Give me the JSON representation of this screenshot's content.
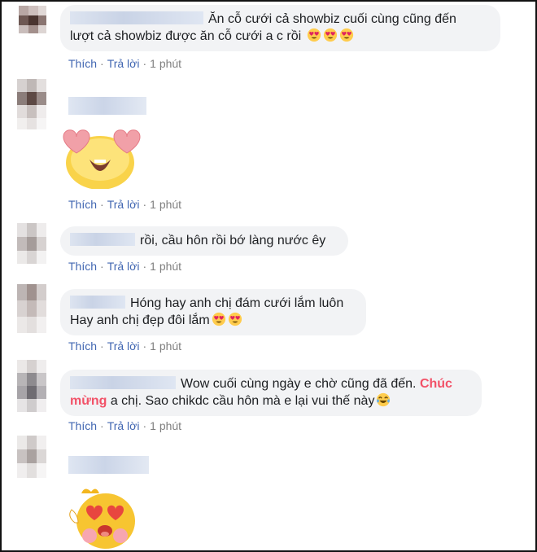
{
  "comments": [
    {
      "text_line1": "Ăn cỗ cưới cả showbiz cuối cùng cũng đến",
      "text_line2": "lượt cả showbiz được ăn cỗ cưới a c rồi"
    },
    {
      "text": "rồi, cầu hôn rồi bớ làng nước êy"
    },
    {
      "text_line1": "Hóng hay anh chị đám cưới lắm luôn",
      "text_line2": "Hay anh chị đẹp đôi lắm"
    },
    {
      "text_part1": "Wow cuối cùng ngày e chờ cũng đã đến.",
      "highlight": "Chúc mừng",
      "text_part2": "a chị. Sao chikdc cầu hôn mà e lại vui thế này"
    }
  ],
  "actions": {
    "like": "Thích",
    "reply": "Trả lời",
    "sep": "·",
    "time": "1 phút"
  },
  "emoji": {
    "heart_eyes": "heart-eyes-emoji",
    "tears_of_joy": "tears-of-joy-emoji"
  },
  "colors": {
    "link": "#4267b2",
    "highlight": "#f25268",
    "bubble": "#f2f3f5"
  }
}
